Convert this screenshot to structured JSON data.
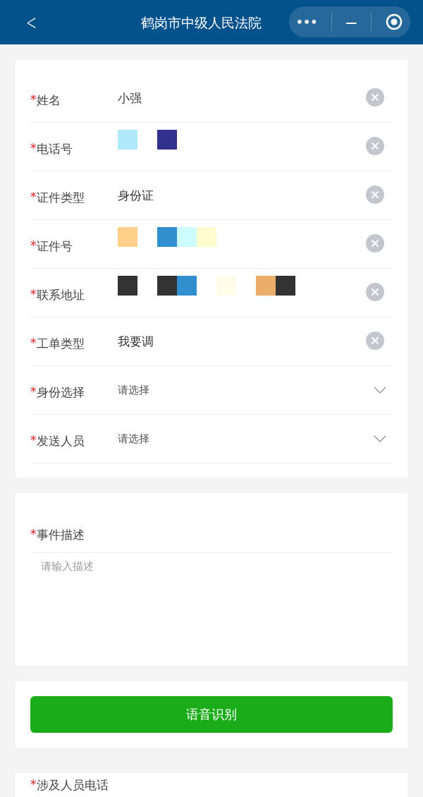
{
  "nav_bar": {
    "title": "鹤岗市中级人民法院",
    "back_label": "<",
    "more_label": "•••",
    "minimize_label": "—"
  },
  "form_fields": [
    {
      "kind": "text",
      "required_mark": "*",
      "label": "姓名",
      "value": "小强"
    },
    {
      "kind": "redacted",
      "required_mark": "*",
      "label": "电话号",
      "groups": [
        [
          {
            "color": "#b0e8fc"
          }
        ],
        [
          {
            "color": "#32318e"
          }
        ]
      ]
    },
    {
      "kind": "text",
      "required_mark": "*",
      "label": "证件类型",
      "value": "身份证"
    },
    {
      "kind": "redacted",
      "required_mark": "*",
      "label": "证件号",
      "groups": [
        [
          {
            "color": "#ffd08a"
          }
        ],
        [
          {
            "color": "#318fd0"
          },
          {
            "color": "#ccfcfc"
          },
          {
            "color": "#fffcd0"
          }
        ]
      ]
    },
    {
      "kind": "redacted",
      "required_mark": "*",
      "label": "联系地址",
      "groups": [
        [
          {
            "color": "#333333"
          }
        ],
        [
          {
            "color": "#333333"
          },
          {
            "color": "#318fd0"
          }
        ],
        [
          {
            "color": "#fffdea"
          }
        ],
        [
          {
            "color": "#eaae6a"
          },
          {
            "color": "#333333"
          }
        ]
      ]
    },
    {
      "kind": "text",
      "required_mark": "*",
      "label": "工单类型",
      "value": "我要调"
    },
    {
      "kind": "select",
      "required_mark": "*",
      "label": "身份选择",
      "placeholder": "请选择"
    },
    {
      "kind": "select",
      "required_mark": "*",
      "label": "发送人员",
      "placeholder": "请选择"
    }
  ],
  "description": {
    "required_mark": "*",
    "label": "事件描述",
    "placeholder": "请输入描述"
  },
  "voice_button": "语音识别",
  "next_section": {
    "required_mark": "*",
    "label": "涉及人员电话"
  }
}
